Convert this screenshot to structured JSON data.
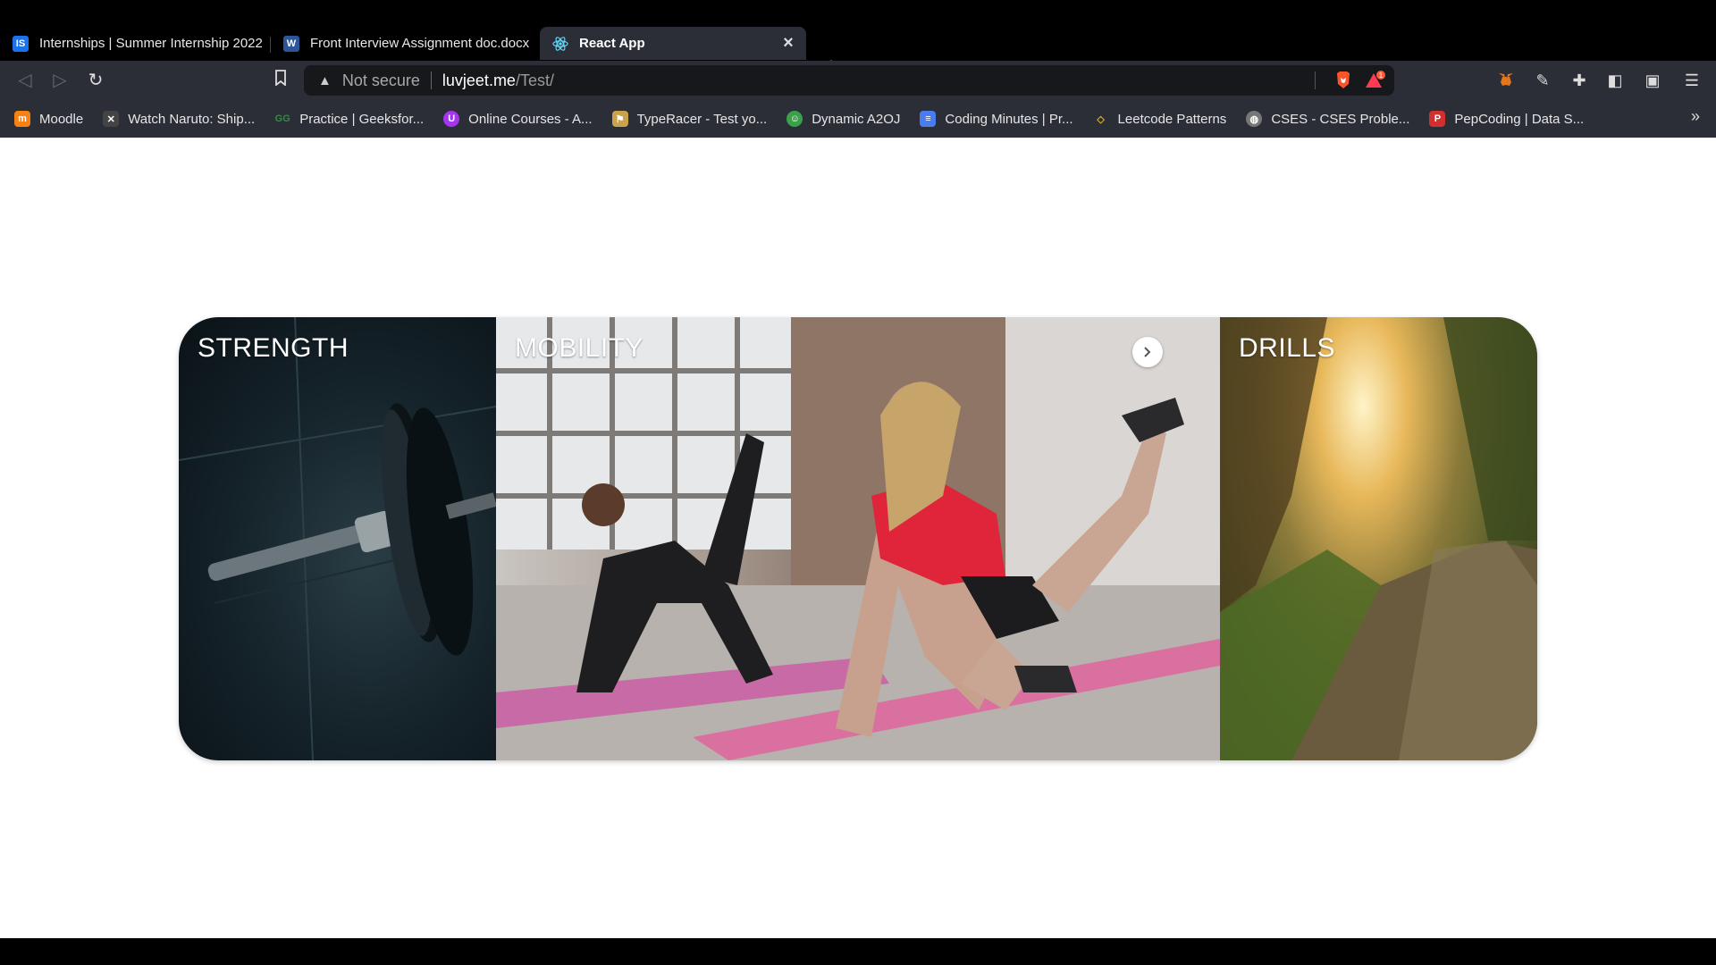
{
  "tabs": [
    {
      "title": "Internships | Summer Internship 2022",
      "favicon": "IS",
      "color": "#1a73e8"
    },
    {
      "title": "Front Interview Assignment doc.docx",
      "favicon": "W",
      "color": "#2b579a"
    },
    {
      "title": "React App",
      "favicon": "react-icon",
      "color": "#61dafb"
    }
  ],
  "toolbar": {
    "not_secure": "Not secure",
    "url_host": "luvjeet.me",
    "url_path": "/Test/"
  },
  "bookmarks": [
    {
      "label": "Moodle",
      "icon": "moodle-icon",
      "color": "#f98012"
    },
    {
      "label": "Watch Naruto: Ship...",
      "icon": "naruto-icon",
      "color": "#444"
    },
    {
      "label": "Practice | Geeksfor...",
      "icon": "gfg-icon",
      "color": "#2f8d46"
    },
    {
      "label": "Online Courses - A...",
      "icon": "udemy-icon",
      "color": "#a435f0"
    },
    {
      "label": "TypeRacer - Test yo...",
      "icon": "typeracer-icon",
      "color": "#c9a24a"
    },
    {
      "label": "Dynamic A2OJ",
      "icon": "a2oj-icon",
      "color": "#3aa14a"
    },
    {
      "label": "Coding Minutes | Pr...",
      "icon": "doc-icon",
      "color": "#4a7bf0"
    },
    {
      "label": "Leetcode Patterns",
      "icon": "leetcode-icon",
      "color": "#e2b714"
    },
    {
      "label": "CSES - CSES Proble...",
      "icon": "globe-icon",
      "color": "#777"
    },
    {
      "label": "PepCoding | Data S...",
      "icon": "pepcoding-icon",
      "color": "#d32f2f"
    }
  ],
  "cards": [
    {
      "title": "STRENGTH"
    },
    {
      "title": "MOBILITY"
    },
    {
      "title": "DRILLS"
    }
  ]
}
